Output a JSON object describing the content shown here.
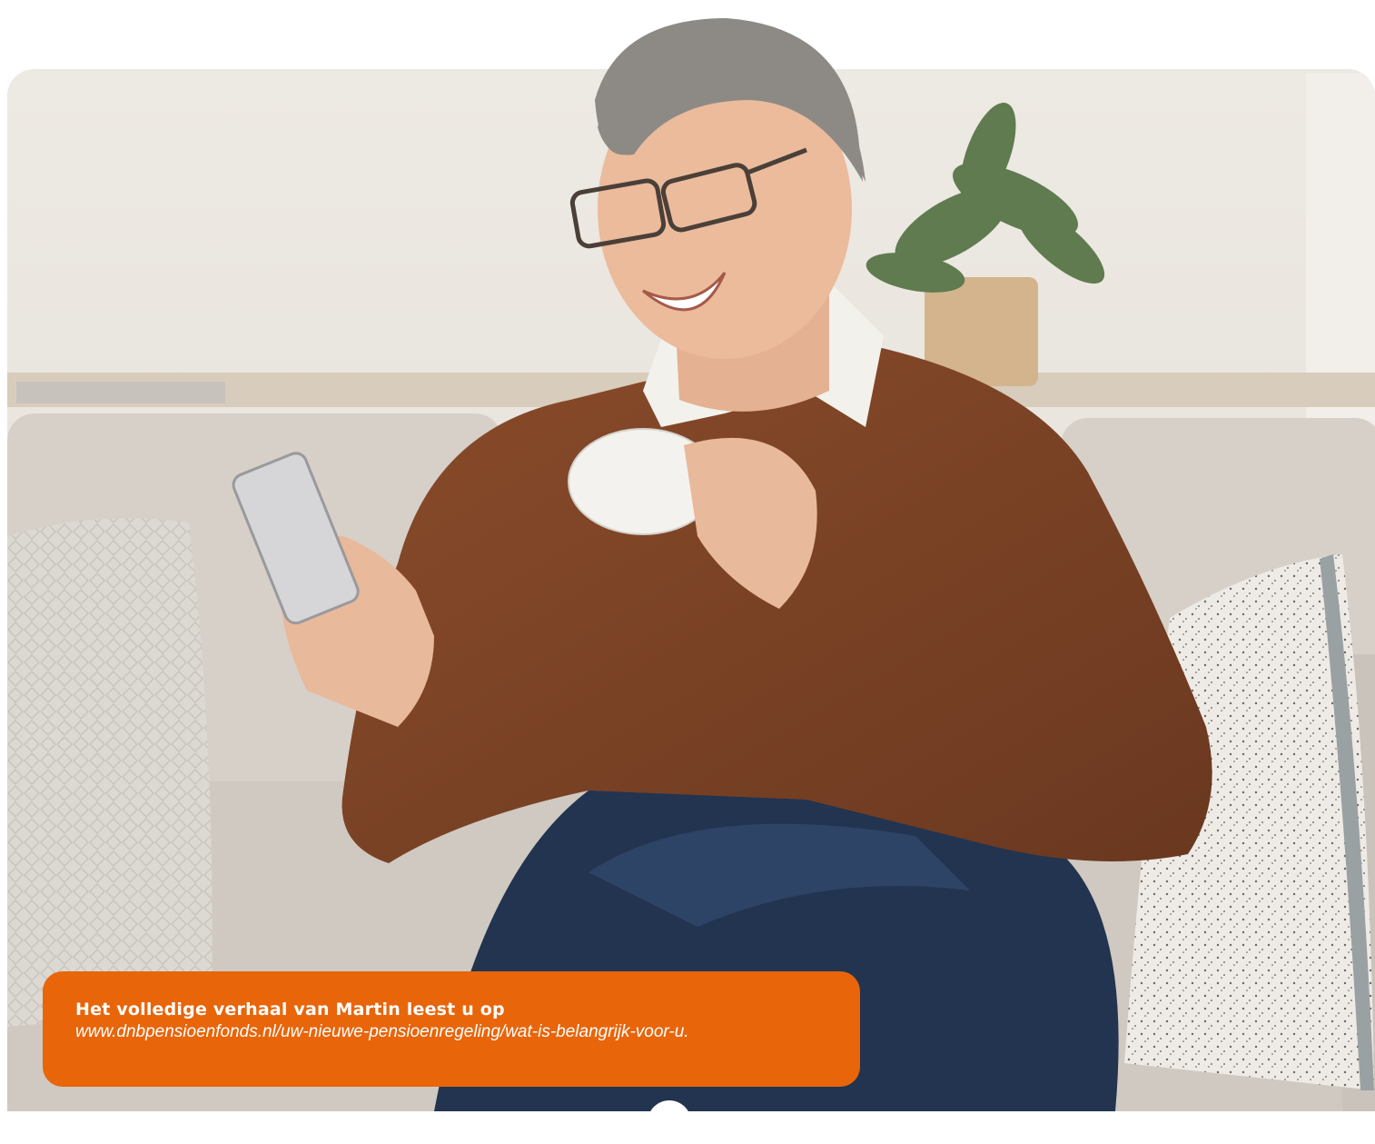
{
  "caption": {
    "title": "Het volledige verhaal van Martin leest u op",
    "url": "www.dnbpensioenfonds.nl/uw-nieuwe-pensioenregeling/wat-is-belangrijk-voor-u."
  },
  "colors": {
    "caption_background": "#e8650a",
    "caption_text": "#ffffff",
    "wall": "#ebe7e1",
    "sofa": "#d3cdc5",
    "sweater": "#7a4426",
    "jeans": "#22344f"
  },
  "photo": {
    "subject": "smiling-older-man-with-phone-and-cup-on-sofa-photo"
  }
}
